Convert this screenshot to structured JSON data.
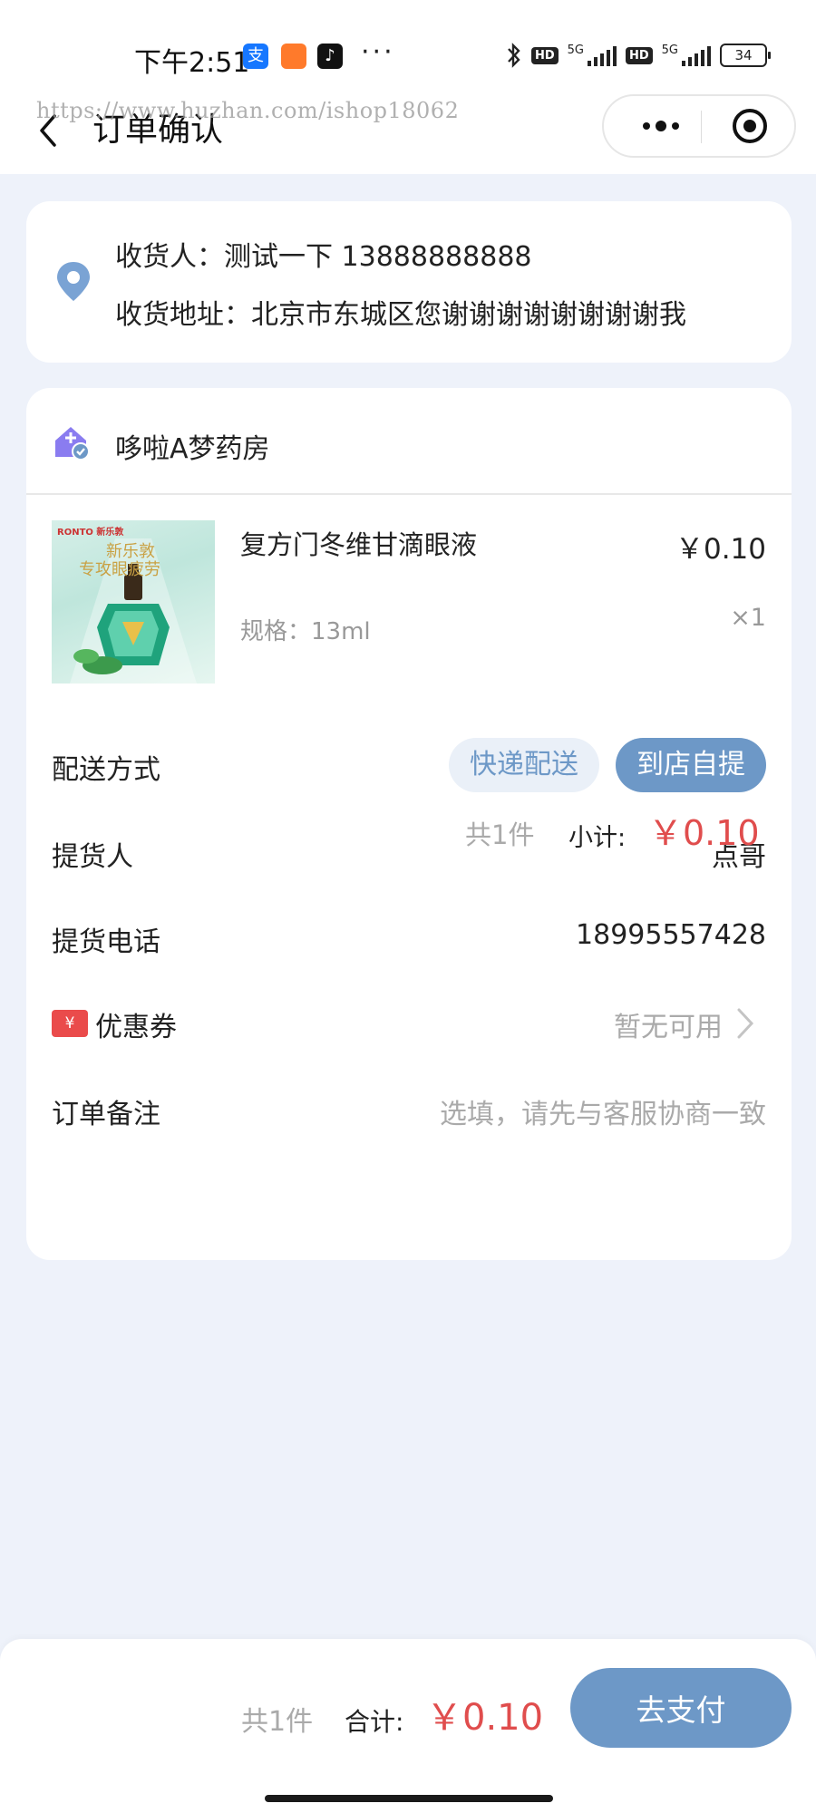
{
  "status_bar": {
    "time": "下午2:51",
    "battery": "34",
    "network": "5G",
    "hd": "HD"
  },
  "nav": {
    "title": "订单确认",
    "watermark": "https://www.huzhan.com/ishop18062"
  },
  "address": {
    "recipient_line": "收货人：测试一下  13888888888",
    "address_line": "收货地址：北京市东城区您谢谢谢谢谢谢谢谢我"
  },
  "store": {
    "name": "哆啦A梦药房"
  },
  "product": {
    "name": "复方门冬维甘滴眼液",
    "price": "￥0.10",
    "spec": "规格：13ml",
    "quantity": "×1",
    "image_brand": "RONTO 新乐敦",
    "image_slogan_1": "新乐敦",
    "image_slogan_2": "专攻眼疲劳"
  },
  "delivery": {
    "label": "配送方式",
    "options": [
      "快递配送",
      "到店自提"
    ],
    "selected": "到店自提"
  },
  "pickup_person": {
    "label": "提货人",
    "value": "点哥"
  },
  "pickup_phone": {
    "label": "提货电话",
    "value": "18995557428"
  },
  "coupon": {
    "label": "优惠券",
    "value": "暂无可用",
    "icon_symbol": "¥"
  },
  "remark": {
    "label": "订单备注",
    "placeholder": "选填，请先与客服协商一致"
  },
  "subtotal": {
    "count": "共1件",
    "label": "小计:",
    "amount": "￥0.10"
  },
  "footer": {
    "count": "共1件",
    "label": "合计:",
    "amount": "￥0.10",
    "pay_label": "去支付"
  },
  "colors": {
    "accent": "#6d98c7",
    "price_red": "#e04d4d",
    "coupon_red": "#ea4b4b",
    "page_bg": "#eef2fa"
  }
}
